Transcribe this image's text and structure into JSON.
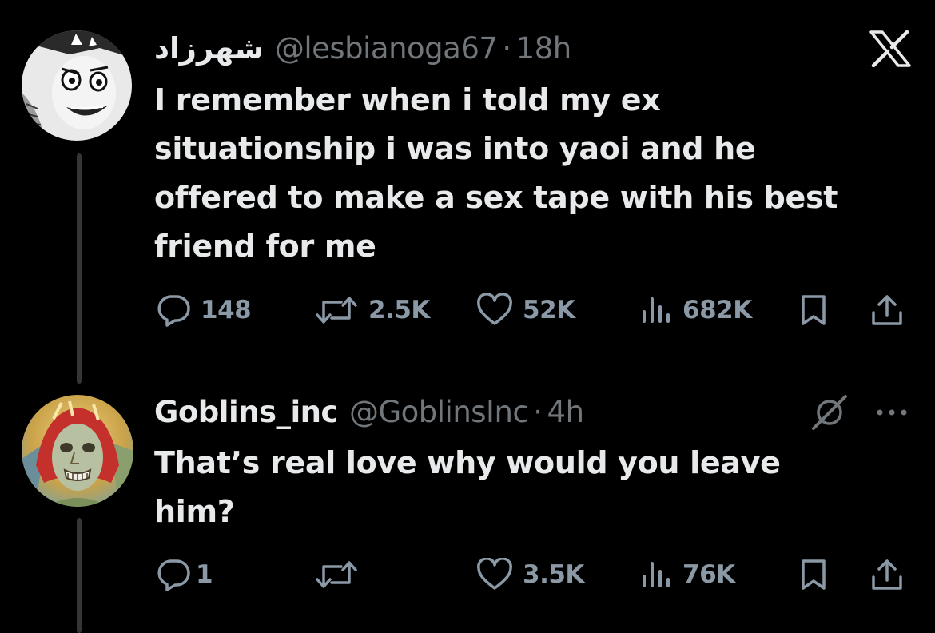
{
  "colors": {
    "background": "#000000",
    "text": "#e7e9ea",
    "muted": "#71767b",
    "action_icon": "#8b98a5",
    "thread_line": "#333639"
  },
  "tweets": [
    {
      "display_name": "شهرزاد",
      "handle": "@lesbianoga67",
      "separator": "·",
      "time": "18h",
      "text_lines": [
        "I remember when i told my ex",
        "situationship i was into yaoi and he",
        "offered to make a sex tape with his best",
        "friend for me"
      ],
      "corner_icon": "x-logo-icon",
      "actions": {
        "replies": "148",
        "reposts": "2.5K",
        "likes": "52K",
        "views": "682K"
      }
    },
    {
      "display_name": "Goblins_inc",
      "handle": "@GoblinsInc",
      "separator": "·",
      "time": "4h",
      "text_lines": [
        "That’s real love why would you leave",
        "him?"
      ],
      "corner_icon": "grok-icon",
      "more_icon": "more-icon",
      "actions": {
        "replies": "1",
        "reposts": "",
        "likes": "3.5K",
        "views": "76K"
      }
    }
  ]
}
